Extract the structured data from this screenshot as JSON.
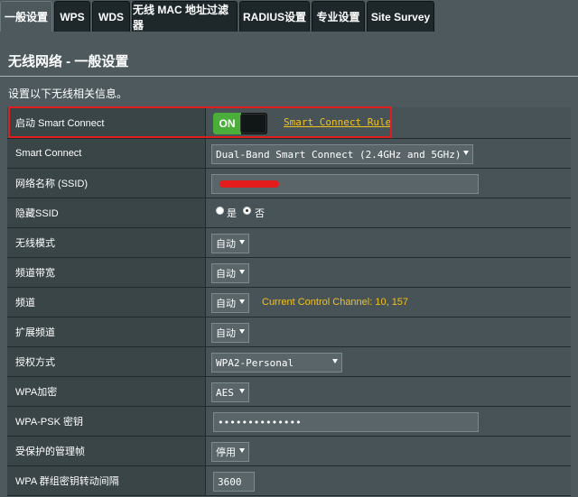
{
  "tabs": [
    {
      "label": "一般设置",
      "active": true
    },
    {
      "label": "WPS",
      "active": false
    },
    {
      "label": "WDS",
      "active": false
    },
    {
      "label": "无线 MAC 地址过滤器",
      "active": false
    },
    {
      "label": "RADIUS设置",
      "active": false
    },
    {
      "label": "专业设置",
      "active": false
    },
    {
      "label": "Site Survey",
      "active": false
    }
  ],
  "page": {
    "title": "无线网络 - 一般设置",
    "intro": "设置以下无线相关信息。"
  },
  "colors": {
    "background": "#4d595d",
    "label_bg": "#3a4548",
    "switch_on": "#4cae3a",
    "accent_yellow": "#f2c21e",
    "highlight_red": "#e01e1e"
  },
  "form": {
    "smart_connect": {
      "label": "启动 Smart Connect",
      "switch_state": "ON",
      "rule_link": "Smart Connect Rule"
    },
    "smart_connect_mode": {
      "label": "Smart Connect",
      "value": "Dual-Band Smart Connect (2.4GHz and 5GHz)"
    },
    "ssid": {
      "label": "网络名称 (SSID)",
      "value_redacted": true
    },
    "hide_ssid": {
      "label": "隐藏SSID",
      "option_yes": "是",
      "option_no": "否",
      "selected": "否"
    },
    "wireless_mode": {
      "label": "无线模式",
      "value": "自动"
    },
    "channel_bandwidth": {
      "label": "频道带宽",
      "value": "自动"
    },
    "channel": {
      "label": "频道",
      "value": "自动",
      "info": "Current Control Channel: 10, 157"
    },
    "extension_channel": {
      "label": "扩展频道",
      "value": "自动"
    },
    "auth_method": {
      "label": "授权方式",
      "value": "WPA2-Personal"
    },
    "wpa_encryption": {
      "label": "WPA加密",
      "value": "AES"
    },
    "wpa_psk": {
      "label": "WPA-PSK 密钥",
      "value": "••••••••••••••"
    },
    "protected_mgmt": {
      "label": "受保护的管理帧",
      "value": "停用"
    },
    "group_key_interval": {
      "label": "WPA 群组密钥转动间隔",
      "value": "3600"
    }
  }
}
